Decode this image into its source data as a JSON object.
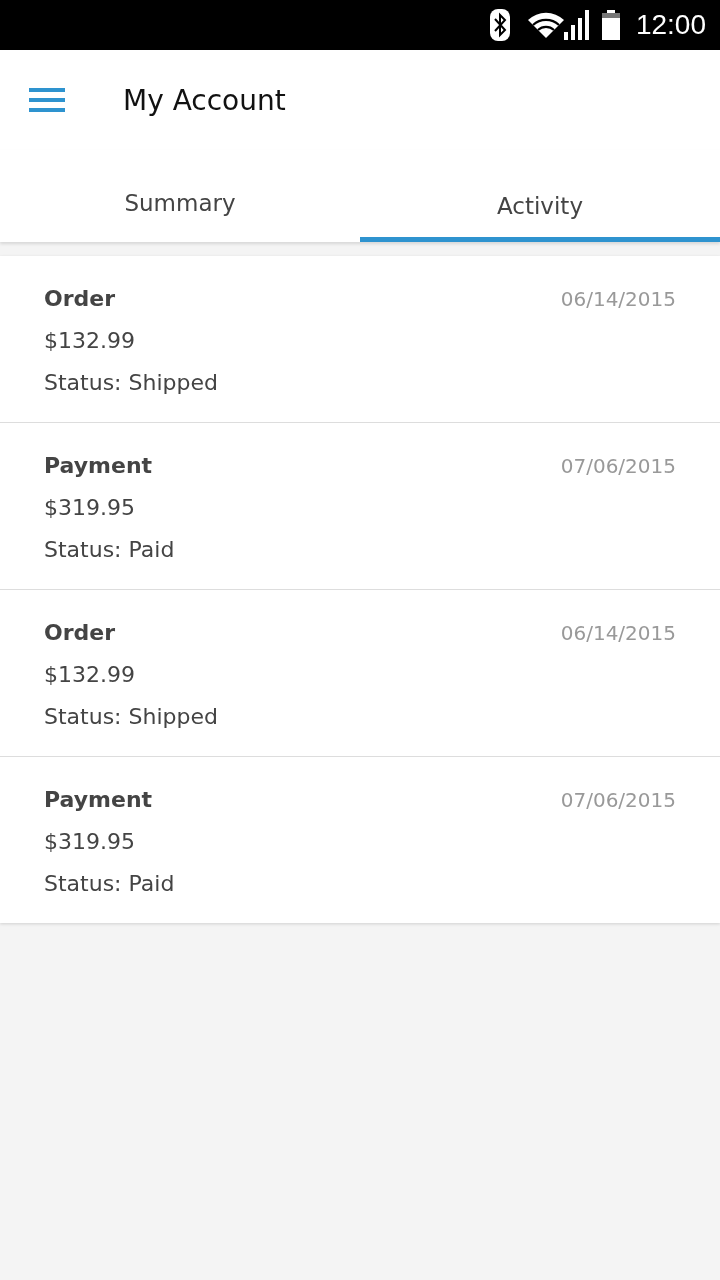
{
  "status_bar": {
    "time": "12:00"
  },
  "app_bar": {
    "title": "My Account"
  },
  "tabs": [
    {
      "label": "Summary",
      "selected": false
    },
    {
      "label": "Activity",
      "selected": true
    }
  ],
  "activity": [
    {
      "title": "Order",
      "amount": "$132.99",
      "status": "Status: Shipped",
      "date": "06/14/2015"
    },
    {
      "title": "Payment",
      "amount": "$319.95",
      "status": "Status: Paid",
      "date": "07/06/2015"
    },
    {
      "title": "Order",
      "amount": "$132.99",
      "status": "Status: Shipped",
      "date": "06/14/2015"
    },
    {
      "title": "Payment",
      "amount": "$319.95",
      "status": "Status: Paid",
      "date": "07/06/2015"
    }
  ]
}
